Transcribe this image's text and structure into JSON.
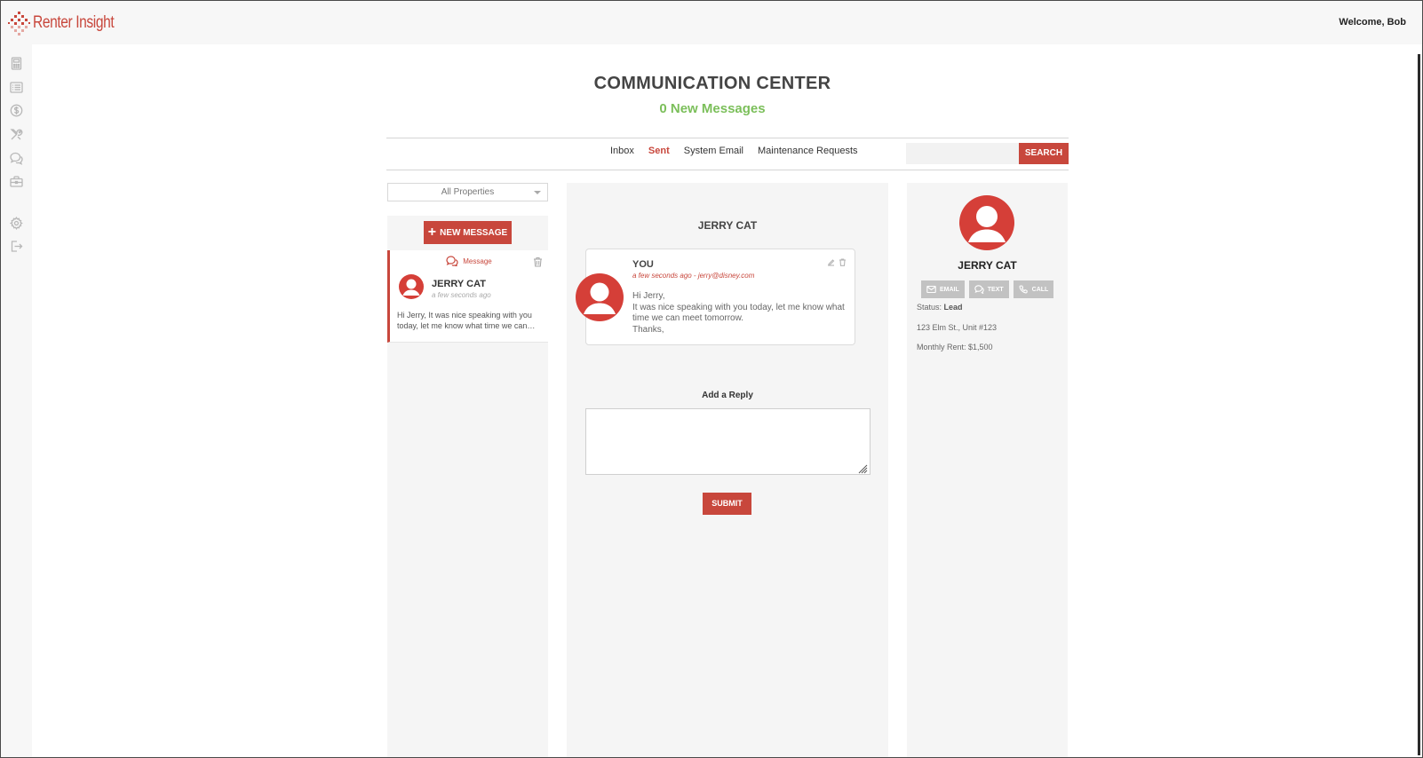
{
  "header": {
    "brand": "Renter Insight",
    "welcome": "Welcome, Bob"
  },
  "sidebar": {
    "icons": [
      "calculator-icon",
      "list-icon",
      "dollar-icon",
      "tools-icon",
      "chat-icon",
      "briefcase-icon",
      "gear-icon",
      "logout-icon"
    ]
  },
  "page": {
    "title": "COMMUNICATION CENTER",
    "new_messages": "0 New Messages"
  },
  "tabs": [
    {
      "label": "Inbox",
      "active": false
    },
    {
      "label": "Sent",
      "active": true
    },
    {
      "label": "System Email",
      "active": false
    },
    {
      "label": "Maintenance Requests",
      "active": false
    }
  ],
  "search": {
    "placeholder": "",
    "button": "SEARCH"
  },
  "filter": {
    "selected": "All Properties"
  },
  "message_list": {
    "new_button": "NEW MESSAGE",
    "items": [
      {
        "type": "Message",
        "name": "JERRY CAT",
        "time": "a few seconds ago",
        "preview": "Hi Jerry, It was nice speaking with you today, let me know what time we can…"
      }
    ]
  },
  "conversation": {
    "name": "JERRY CAT",
    "message": {
      "sender": "YOU",
      "meta": "a few seconds ago - jerry@disney.com",
      "body": [
        "Hi Jerry,",
        "It was nice speaking with you today, let me know what time we can meet tomorrow.",
        "Thanks,"
      ]
    },
    "reply_label": "Add a Reply",
    "reply_value": "",
    "submit": "SUBMIT"
  },
  "contact": {
    "name": "JERRY CAT",
    "buttons": {
      "email": "EMAIL",
      "text": "TEXT",
      "call": "CALL"
    },
    "status_label": "Status:",
    "status_value": "Lead",
    "address": "123 Elm St., Unit #123",
    "rent": "Monthly Rent: $1,500"
  },
  "colors": {
    "accent": "#c8473c",
    "green": "#7bbf5a",
    "panel": "#f5f5f5"
  }
}
